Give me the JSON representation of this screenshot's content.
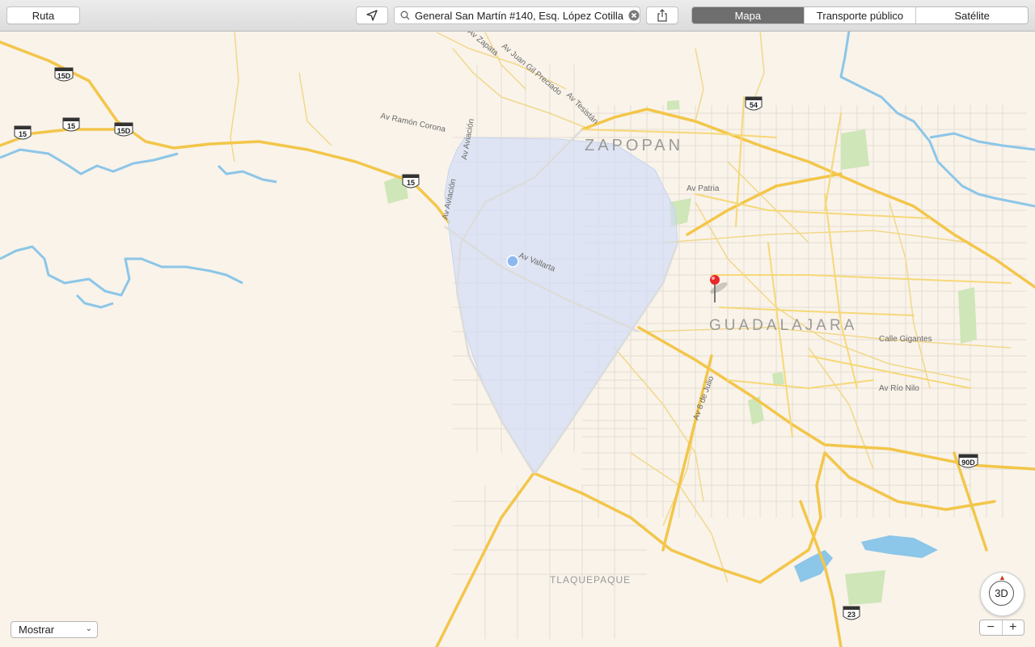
{
  "toolbar": {
    "route_label": "Ruta",
    "location_icon": "location-arrow-icon",
    "search_value": "General San Martín #140,  Esq. López Cotilla",
    "share_icon": "share-icon",
    "segments": [
      "Mapa",
      "Transporte público",
      "Satélite"
    ],
    "selected_segment": "Mapa"
  },
  "map": {
    "cities": [
      "ZAPOPAN",
      "GUADALAJARA",
      "TLAQUEPAQUE"
    ],
    "streets": [
      "Av Ramón Corona",
      "Av Aviación",
      "Av Juan Gil Preciado",
      "Av Tesistán",
      "Av Patria",
      "Calle Gigantes",
      "Av Río Nilo",
      "Av 8 de Julio",
      "Av Vallarta",
      "Av Zapata"
    ],
    "shields": [
      "15D",
      "15",
      "15",
      "15D",
      "15",
      "54",
      "90D",
      "23"
    ]
  },
  "bottom": {
    "show_label": "Mostrar",
    "compass_label": "3D",
    "zoom_out": "−",
    "zoom_in": "+"
  }
}
